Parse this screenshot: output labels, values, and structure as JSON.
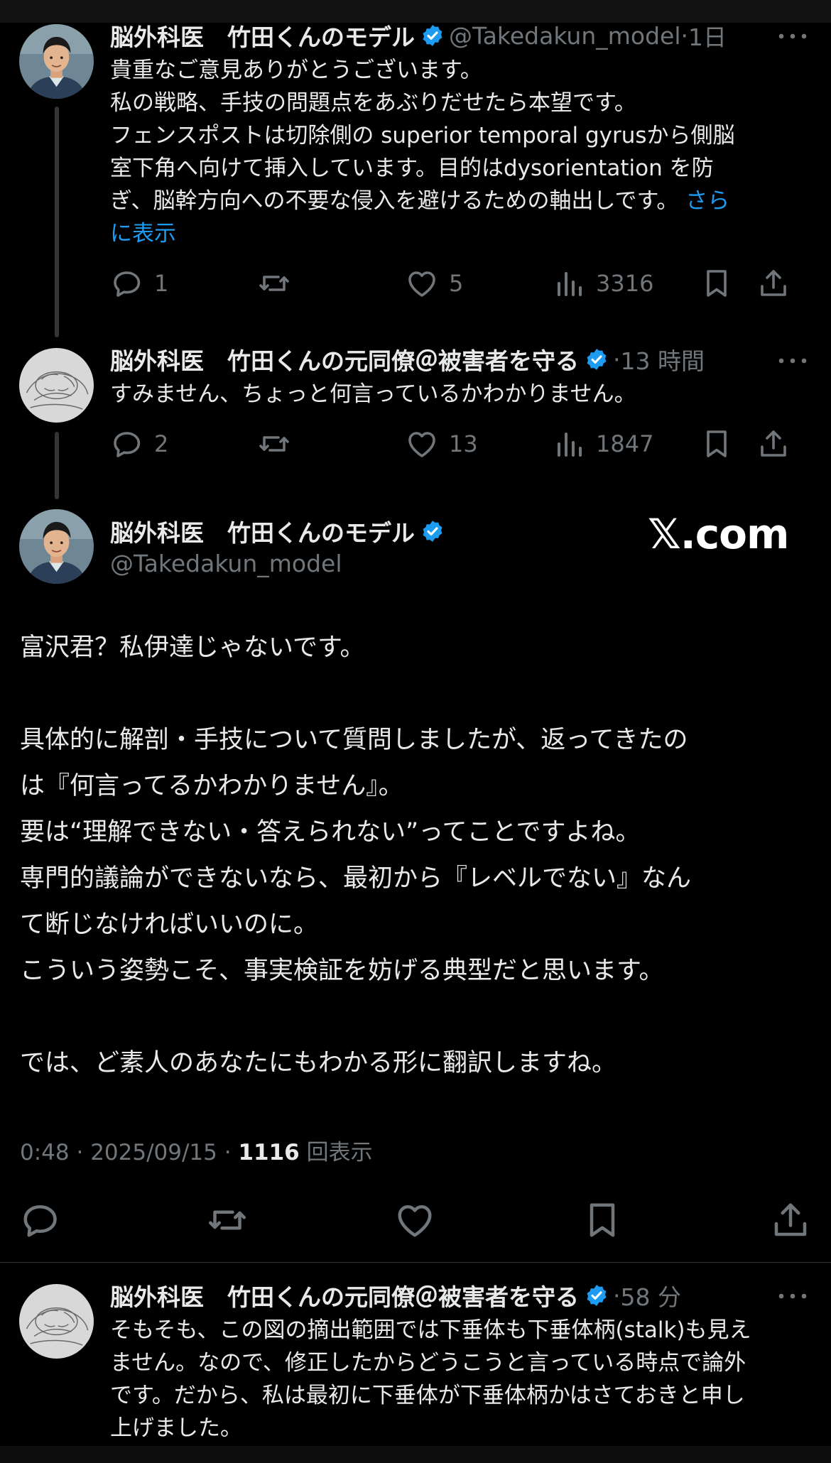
{
  "reply1": {
    "author_name": "脳外科医　竹田くんのモデル",
    "handle": "@Takedakun_model",
    "time": "1日",
    "lines": [
      "貴重なご意見ありがとうございます。",
      "私の戦略、手技の問題点をあぶりだせたら本望です。",
      "フェンスポストは切除側の superior temporal gyrusから側脳",
      "室下角へ向けて挿入しています。目的はdysorientation を防",
      "ぎ、脳幹方向への不要な侵入を避けるための軸出しです。"
    ],
    "show_more_1": "さら",
    "show_more_2": "に表示",
    "replies": "1",
    "reposts": "",
    "likes": "5",
    "views": "3316"
  },
  "reply2": {
    "author_name": "脳外科医　竹田くんの元同僚＠被害者を守る",
    "time": "13 時間",
    "text": "すみません、ちょっと何言っているかわかりません。",
    "replies": "2",
    "reposts": "",
    "likes": "13",
    "views": "1847"
  },
  "main": {
    "author_name": "脳外科医　竹田くんのモデル",
    "handle": "@Takedakun_model",
    "watermark": "𝕏.com",
    "lines": [
      "富沢君？私伊達じゃないです。",
      "",
      "具体的に解剖・手技について質問しましたが、返ってきたの",
      "は『何言ってるかわかりません』。",
      "要は“理解できない・答えられない”ってことですよね。",
      "専門的議論ができないなら、最初から『レベルでない』なん",
      "て断じなければいいのに。",
      "こういう姿勢こそ、事実検証を妨げる典型だと思います。",
      "",
      "では、ど素人のあなたにもわかる形に翻訳しますね。"
    ],
    "time": "0:48",
    "date": "2025/09/15",
    "view_count": "1116",
    "view_label": "回表示"
  },
  "reply3": {
    "author_name": "脳外科医　竹田くんの元同僚＠被害者を守る",
    "time": "58 分",
    "lines": [
      "そもそも、この図の摘出範囲では下垂体も下垂体柄(stalk)も見え",
      "ません。なので、修正したからどうこうと言っている時点で論外",
      "です。だから、私は最初に下垂体が下垂体柄かはさておきと申し",
      "上げました。"
    ]
  },
  "colors": {
    "background": "#000000",
    "text": "#e7e9ea",
    "muted": "#71767b",
    "link": "#1d9bf0",
    "verified": "#1d9bf0"
  },
  "icons": [
    "reply-icon",
    "repost-icon",
    "like-icon",
    "views-icon",
    "bookmark-icon",
    "share-icon",
    "verified-badge-icon",
    "more-icon"
  ]
}
